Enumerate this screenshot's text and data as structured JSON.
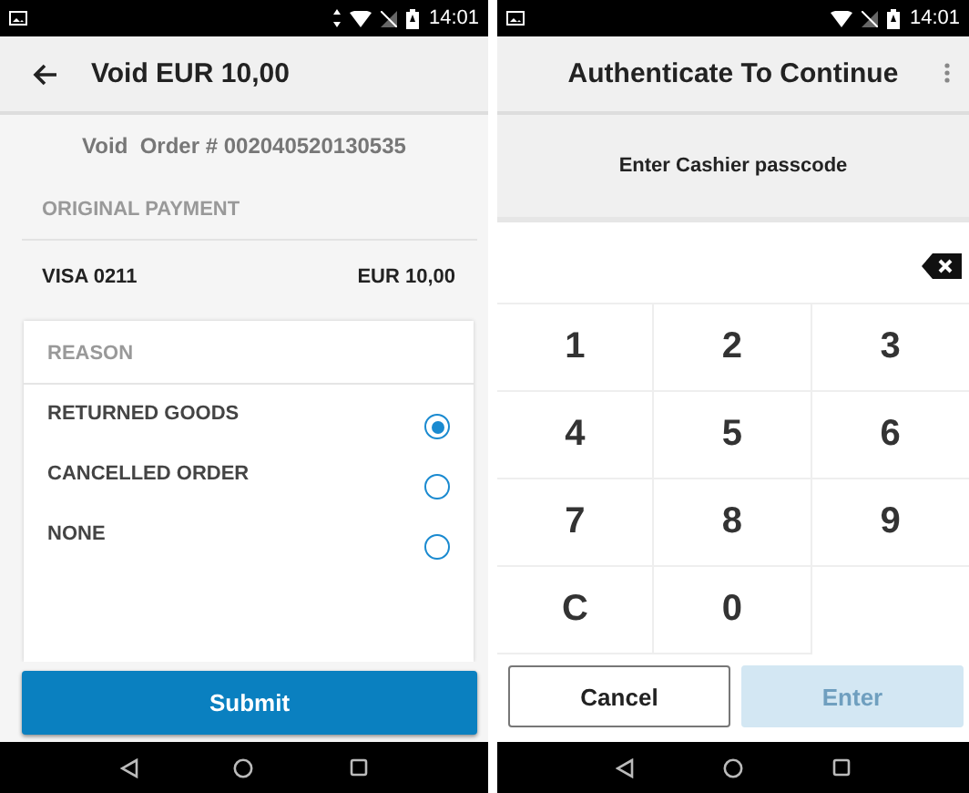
{
  "void_screen": {
    "status_bar": {
      "time": "14:01",
      "vibrate": true
    },
    "app_bar": {
      "title": "Void EUR 10,00"
    },
    "order_line": "Void  Order # 002040520130535",
    "section_title": "ORIGINAL PAYMENT",
    "payment": {
      "card": "VISA 0211",
      "amount": "EUR 10,00"
    },
    "reason": {
      "title": "REASON",
      "options": [
        {
          "label": "RETURNED GOODS",
          "selected": true
        },
        {
          "label": "CANCELLED ORDER",
          "selected": false
        },
        {
          "label": "NONE",
          "selected": false
        }
      ]
    },
    "submit_button": "Submit"
  },
  "auth_screen": {
    "status_bar": {
      "time": "14:01",
      "vibrate": false
    },
    "app_bar": {
      "title": "Authenticate To Continue"
    },
    "prompt": "Enter Cashier passcode",
    "keys": [
      "1",
      "2",
      "3",
      "4",
      "5",
      "6",
      "7",
      "8",
      "9",
      "C",
      "0"
    ],
    "buttons": [
      {
        "label": "Cancel",
        "kind": "secondary",
        "disabled": false
      },
      {
        "label": "Enter",
        "kind": "primary",
        "disabled": true
      }
    ]
  }
}
